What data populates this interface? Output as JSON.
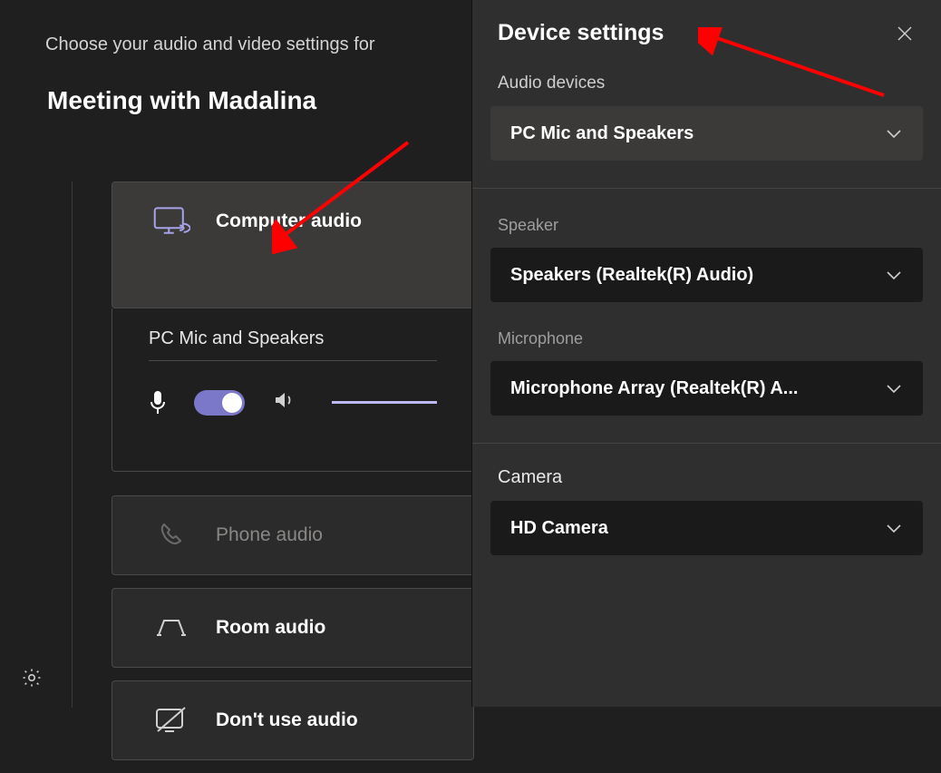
{
  "prejoin": {
    "subtitle": "Choose your audio and video settings for",
    "title": "Meeting with Madalina",
    "options": {
      "computer_audio": "Computer audio",
      "phone_audio": "Phone audio",
      "room_audio": "Room audio",
      "no_audio": "Don't use audio"
    },
    "selected_device_label": "PC Mic and Speakers"
  },
  "panel": {
    "title": "Device settings",
    "audio_devices_label": "Audio devices",
    "audio_device_value": "PC Mic and Speakers",
    "speaker_label": "Speaker",
    "speaker_value": "Speakers (Realtek(R) Audio)",
    "microphone_label": "Microphone",
    "microphone_value": "Microphone Array (Realtek(R) A...",
    "camera_label": "Camera",
    "camera_value": "HD Camera"
  }
}
